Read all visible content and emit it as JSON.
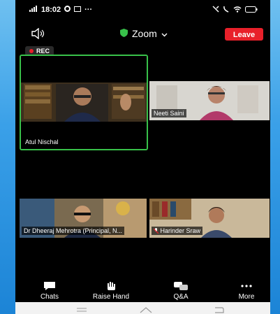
{
  "statusbar": {
    "time": "18:02",
    "signal": "4G",
    "extra": "···"
  },
  "meeting": {
    "title": "Zoom",
    "leave_label": "Leave",
    "rec_label": "REC"
  },
  "participants": [
    {
      "name": "Atul Nischal"
    },
    {
      "name": "Neeti Saini"
    },
    {
      "name": "Dr Dheeraj Mehrotra (Principal, N..."
    },
    {
      "name": "Harinder Sraw"
    }
  ],
  "toolbar": {
    "chats": "Chats",
    "raise_hand": "Raise Hand",
    "qa": "Q&A",
    "more": "More"
  },
  "colors": {
    "accent_green": "#38c14a",
    "leave_red": "#e8202a"
  }
}
